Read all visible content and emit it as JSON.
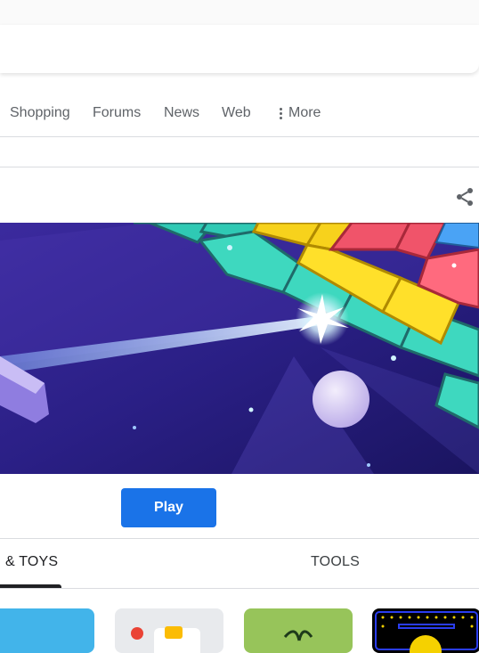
{
  "nav": {
    "tabs": [
      "Shopping",
      "Forums",
      "News",
      "Web"
    ],
    "more_label": "More"
  },
  "share": {
    "icon": "share-icon"
  },
  "game": {
    "play_label": "Play"
  },
  "categories": {
    "active": "& TOYS",
    "second": "TOOLS"
  },
  "cards": [
    "blue-card",
    "dice-card",
    "bug-card",
    "pacman-card"
  ],
  "colors": {
    "accent": "#1a73e8",
    "text": "#202124",
    "muted": "#5f6368",
    "divider": "#dadce0"
  }
}
